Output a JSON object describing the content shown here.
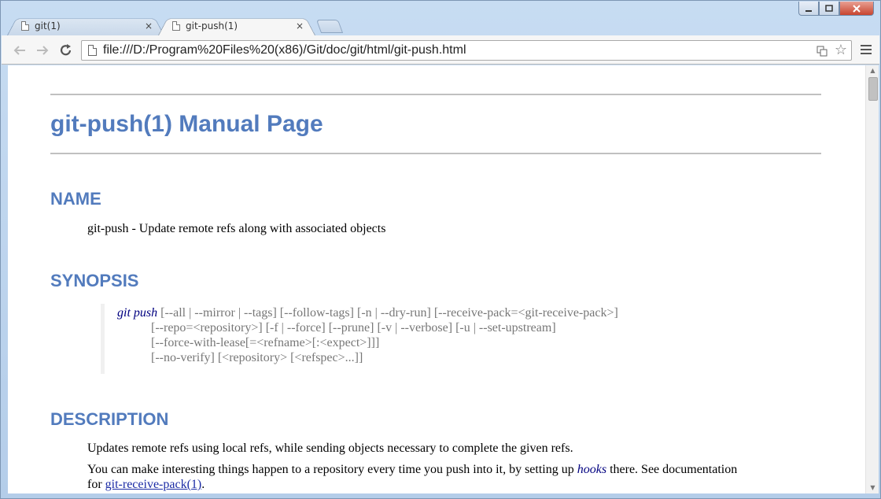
{
  "browser": {
    "tabs": [
      {
        "title": "git(1)",
        "close": "×"
      },
      {
        "title": "git-push(1)",
        "close": "×"
      }
    ],
    "url": "file:///D:/Program%20Files%20(x86)/Git/doc/git/html/git-push.html"
  },
  "page": {
    "title": "git-push(1) Manual Page",
    "name_heading": "NAME",
    "name_text": "git-push - Update remote refs along with associated objects",
    "synopsis_heading": "SYNOPSIS",
    "synopsis": {
      "command": "git push",
      "line1": " [--all | --mirror | --tags] [--follow-tags] [-n | --dry-run] [--receive-pack=<git-receive-pack>]",
      "line2": "[--repo=<repository>] [-f | --force] [--prune] [-v | --verbose] [-u | --set-upstream]",
      "line3": "[--force-with-lease[=<refname>[:<expect>]]]",
      "line4": "[--no-verify] [<repository> [<refspec>...]]"
    },
    "description_heading": "DESCRIPTION",
    "desc_para1": "Updates remote refs using local refs, while sending objects necessary to complete the given refs.",
    "desc_para2_a": "You can make interesting things happen to a repository every time you push into it, by setting up ",
    "desc_para2_hooks": "hooks",
    "desc_para2_b": " there. See documentation",
    "desc_para2_c": "for ",
    "desc_para2_link": "git-receive-pack(1)",
    "desc_para2_d": "."
  }
}
